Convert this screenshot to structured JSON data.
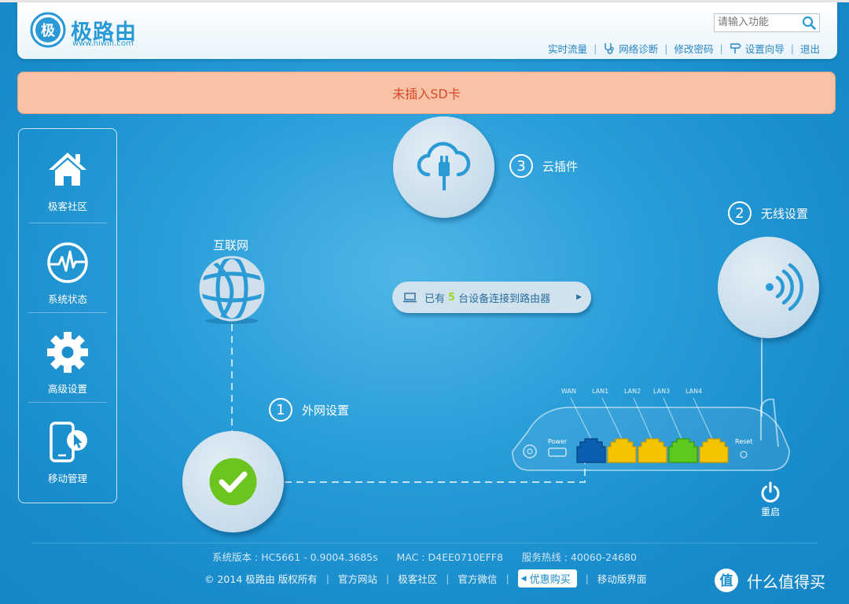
{
  "header": {
    "brand": "极路由",
    "brand_url": "www.hiwifi.com",
    "search_placeholder": "请输入功能",
    "links": {
      "traffic": "实时流量",
      "diagnose": "网络诊断",
      "password": "修改密码",
      "wizard": "设置向导",
      "logout": "退出"
    }
  },
  "alert": {
    "text": "未插入SD卡"
  },
  "sidebar": {
    "items": [
      {
        "label": "极客社区",
        "icon": "home-icon"
      },
      {
        "label": "系统状态",
        "icon": "pulse-icon"
      },
      {
        "label": "高级设置",
        "icon": "gear-icon"
      },
      {
        "label": "移动管理",
        "icon": "mobile-icon"
      }
    ]
  },
  "main": {
    "internet_label": "互联网",
    "step1": {
      "num": "1",
      "label": "外网设置"
    },
    "step2": {
      "num": "2",
      "label": "无线设置"
    },
    "step3": {
      "num": "3",
      "label": "云插件"
    },
    "devices": {
      "prefix": "已有",
      "count": "5",
      "suffix": "台设备连接到路由器",
      "arrow": "▶"
    },
    "router": {
      "ports": [
        "WAN",
        "LAN1",
        "LAN2",
        "LAN3",
        "LAN4"
      ],
      "power_label": "Power",
      "reset_label": "Reset"
    },
    "restart_label": "重启"
  },
  "footer": {
    "version": "系统版本 : HC5661 - 0.9004.3685s",
    "mac": "MAC : D4EE0710EFF8",
    "hotline": "服务热线 : 40060-24680",
    "copyright": "© 2014 极路由 版权所有",
    "official_site": "官方网站",
    "community": "极客社区",
    "wechat": "官方微信",
    "sale": "优惠购买",
    "mobile": "移动版界面"
  },
  "watermark": {
    "text": "什么值得买"
  },
  "colors": {
    "background": "#1a8dcc",
    "alert_bg": "#f7c3a4",
    "alert_text": "#d9492c",
    "port_wan": "#0b5fb0",
    "port_lan": "#f5c400",
    "port_active": "#5cc91e"
  }
}
